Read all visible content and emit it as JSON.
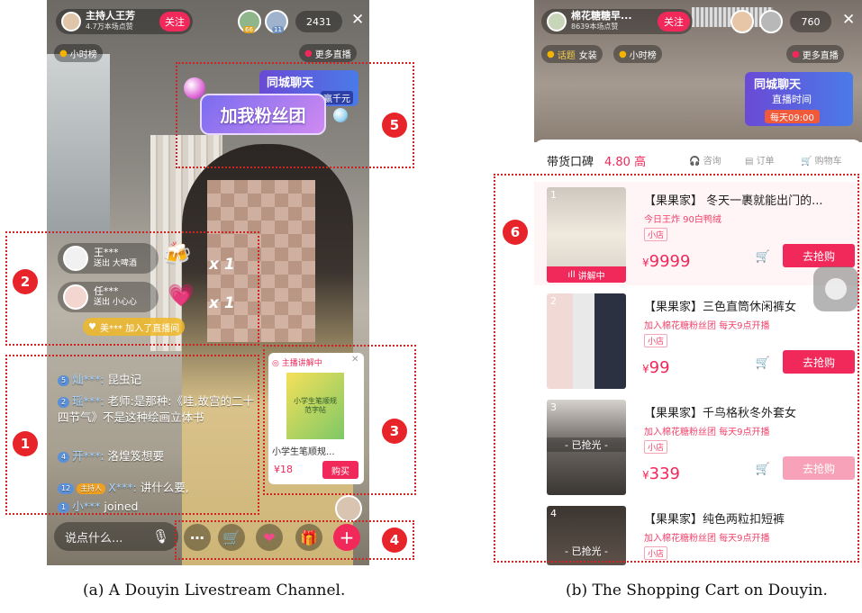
{
  "left": {
    "host_name": "主持人王芳",
    "host_likes": "4.7万本场点赞",
    "follow": "关注",
    "viewer_a": "66",
    "viewer_b": "11",
    "viewer_count": "2431",
    "close": "✕",
    "hourly_rank": "小时榜",
    "more_live": "更多直播",
    "banner_city": "同城聊天",
    "banner_win": "赢千元",
    "fan_club": "加我粉丝团",
    "gifts": [
      {
        "name": "王***",
        "sub": "送出 大啤酒",
        "count": "x 1"
      },
      {
        "name": "任***",
        "sub": "送出 小心心",
        "count": "x 1"
      }
    ],
    "joined_notice": "美*** 加入了直播间",
    "chat": [
      {
        "level": "5",
        "user": "灿***:",
        "text": "昆虫记"
      },
      {
        "level": "2",
        "user": "瑶***:",
        "text": "老师:是那种:《哇,故宫的二十四节气》不是这种绘画立体书"
      },
      {
        "level": "4",
        "user": "开***:",
        "text": "洛煌笈想要"
      },
      {
        "level": "12",
        "badge": "主持人",
        "user": "X***:",
        "text": "讲什么要,"
      },
      {
        "level": "1",
        "user": "小***",
        "text": "joined"
      }
    ],
    "product_pop": {
      "tag": "主播讲解中",
      "book_title": "小学生笔顺规范字帖",
      "name": "小学生笔顺规...",
      "price": "¥18",
      "buy": "购买"
    },
    "say_placeholder": "说点什么...",
    "markers": [
      "1",
      "2",
      "3",
      "4",
      "5"
    ]
  },
  "right": {
    "host_name": "棉花糖糖早...",
    "host_likes": "8639本场点赞",
    "follow": "关注",
    "viewer_count": "760",
    "close": "✕",
    "topic": "话题",
    "topic_value": "女装",
    "hourly_rank": "小时榜",
    "more_live": "更多直播",
    "banner_city": "同城聊天",
    "banner_time": "直播时间",
    "banner_daily": "每天09:00",
    "rating_label": "带货口碑",
    "rating_value": "4.80 高",
    "consult": "咨询",
    "orders": "订单",
    "cart": "购物车",
    "marker": "6",
    "products": [
      {
        "index": "1",
        "title": "【果果家】 冬天一裹就能出门的...",
        "sub": "今日王炸 90白鸭绒",
        "tag": "小店",
        "price": "9999",
        "buy": "去抢购",
        "live": "讲解中",
        "sold": ""
      },
      {
        "index": "2",
        "title": "【果果家】三色直筒休闲裤女",
        "sub": "加入棉花糖粉丝团 每天9点开播",
        "tag": "小店",
        "price": "99",
        "buy": "去抢购",
        "live": "",
        "sold": ""
      },
      {
        "index": "3",
        "title": "【果果家】千鸟格秋冬外套女",
        "sub": "加入棉花糖粉丝团 每天9点开播",
        "tag": "小店",
        "price": "339",
        "buy": "去抢购",
        "live": "",
        "sold": "- 已抢光 -"
      },
      {
        "index": "4",
        "title": "【果果家】纯色两粒扣短裤",
        "sub": "加入棉花糖粉丝团 每天9点开播",
        "tag": "小店",
        "price": "",
        "buy": "",
        "live": "",
        "sold": "- 已抢光 -"
      }
    ]
  },
  "captions": {
    "left": "(a) A Douyin Livestream Channel.",
    "right": "(b) The Shopping Cart on Douyin."
  },
  "colors": {
    "accent": "#f0295a",
    "marker": "#e6242a"
  }
}
